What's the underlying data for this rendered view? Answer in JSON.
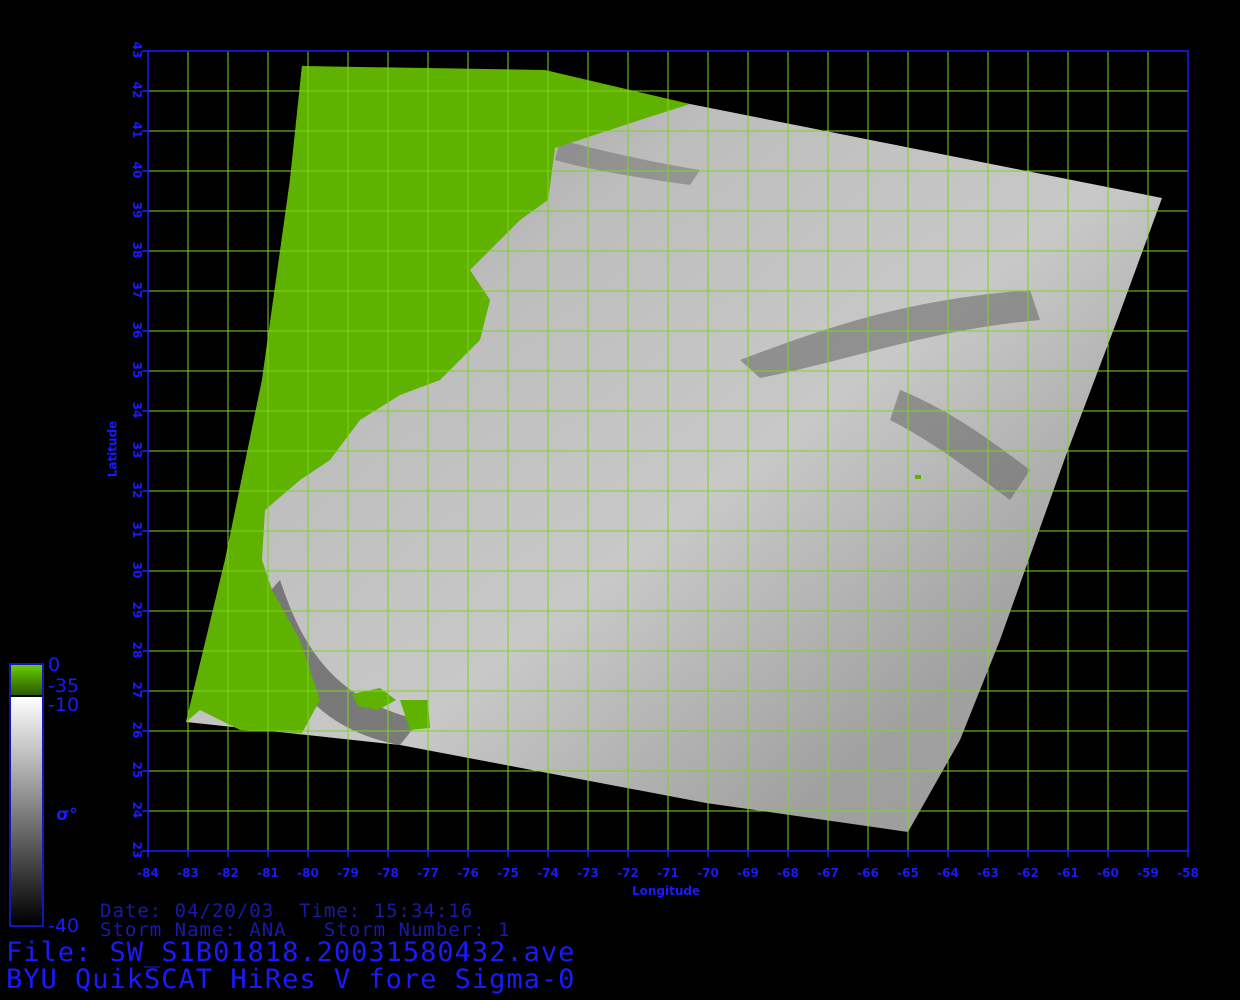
{
  "map": {
    "lat_ticks": [
      "43",
      "42",
      "41",
      "40",
      "39",
      "38",
      "37",
      "36",
      "35",
      "34",
      "33",
      "32",
      "31",
      "30",
      "29",
      "28",
      "27",
      "26",
      "25",
      "24",
      "23"
    ],
    "lon_ticks": [
      "-84",
      "-83",
      "-82",
      "-81",
      "-80",
      "-79",
      "-78",
      "-77",
      "-76",
      "-75",
      "-74",
      "-73",
      "-72",
      "-71",
      "-70",
      "-69",
      "-68",
      "-67",
      "-66",
      "-65",
      "-64",
      "-63",
      "-62",
      "-61",
      "-60",
      "-59",
      "-58"
    ],
    "y_axis_title": "Latitude",
    "x_axis_title": "Longitude",
    "lat_range": [
      23,
      43
    ],
    "lon_range": [
      -84,
      -58
    ],
    "grid_color": "#7ed321",
    "frame_color": "#1a1aff",
    "land_color": "#5fb200"
  },
  "colorbar": {
    "land_top": "0",
    "land_bottom": "-35",
    "ocean_top": "-10",
    "ocean_bottom": "-40",
    "symbol": "σ°"
  },
  "info": {
    "date_line": "Date: 04/20/03  Time: 15:34:16",
    "storm_line": "Storm Name: ANA   Storm Number: 1",
    "file_line": "File: SW_S1B01818.20031580432.ave",
    "product_line": "BYU QuikSCAT HiRes V fore Sigma-0"
  }
}
